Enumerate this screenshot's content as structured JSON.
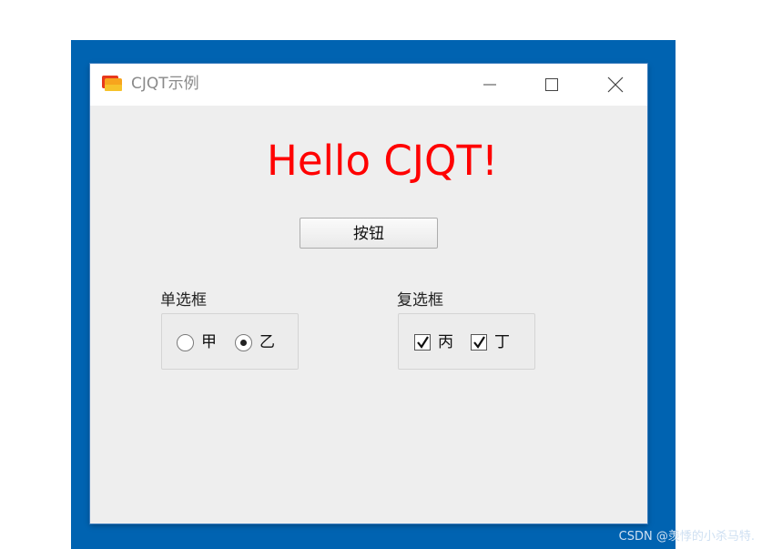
{
  "window": {
    "title": "CJQT示例",
    "app_icon": "app-folder-icon",
    "controls": [
      "minimize-icon",
      "maximize-icon",
      "close-icon"
    ]
  },
  "main": {
    "heading": "Hello CJQT!",
    "heading_color": "#ff0000",
    "button_label": "按钮"
  },
  "radio_group": {
    "label": "单选框",
    "options": [
      {
        "label": "甲",
        "checked": false
      },
      {
        "label": "乙",
        "checked": true
      }
    ]
  },
  "checkbox_group": {
    "label": "复选框",
    "options": [
      {
        "label": "丙",
        "checked": true
      },
      {
        "label": "丁",
        "checked": true
      }
    ]
  },
  "watermark": "CSDN @羡悸的小杀马特."
}
